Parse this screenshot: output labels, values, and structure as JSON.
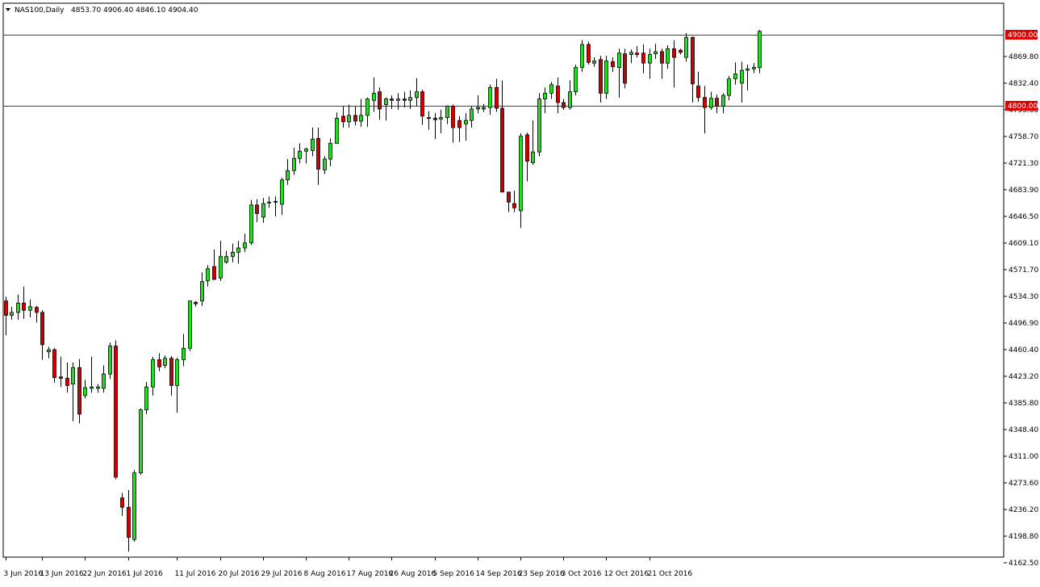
{
  "header": {
    "symbol": "NAS100,Daily",
    "ohlc": "4853.70 4906.40 4846.10 4904.40"
  },
  "colors": {
    "bull": "#22dd22",
    "bear": "#cc0000",
    "wick": "#000000",
    "level_line": "#dd0000",
    "level_label_bg": "#dd0000",
    "level_label_text": "#ffffff",
    "frame": "#000000",
    "background": "#ffffff"
  },
  "chart_data": {
    "type": "candlestick",
    "title": "",
    "xlabel": "",
    "ylabel": "",
    "ylim": [
      4162.5,
      4906.4
    ],
    "grid": false,
    "y_ticks": [
      "4869.80",
      "4832.40",
      "4795.60",
      "4758.70",
      "4721.30",
      "4683.90",
      "4646.50",
      "4609.10",
      "4571.70",
      "4534.30",
      "4496.90",
      "4460.40",
      "4423.20",
      "4385.80",
      "4348.40",
      "4311.00",
      "4273.60",
      "4236.20",
      "4198.80",
      "4162.50"
    ],
    "x_ticks": [
      {
        "index": 0,
        "label": "3 Jun 2016"
      },
      {
        "index": 6,
        "label": "13 Jun 2016"
      },
      {
        "index": 13,
        "label": "22 Jun 2016"
      },
      {
        "index": 20,
        "label": "1 Jul 2016"
      },
      {
        "index": 28,
        "label": "11 Jul 2016"
      },
      {
        "index": 35,
        "label": "20 Jul 2016"
      },
      {
        "index": 42,
        "label": "29 Jul 2016"
      },
      {
        "index": 49,
        "label": "8 Aug 2016"
      },
      {
        "index": 56,
        "label": "17 Aug 2016"
      },
      {
        "index": 63,
        "label": "26 Aug 2016"
      },
      {
        "index": 70,
        "label": "5 Sep 2016"
      },
      {
        "index": 77,
        "label": "14 Sep 2016"
      },
      {
        "index": 84,
        "label": "23 Sep 2016"
      },
      {
        "index": 91,
        "label": "3 Oct 2016"
      },
      {
        "index": 98,
        "label": "12 Oct 2016"
      },
      {
        "index": 105,
        "label": "21 Oct 2016"
      }
    ],
    "levels": [
      {
        "value": 4900.0,
        "label": "4900.00"
      },
      {
        "value": 4800.0,
        "label": "4800.00"
      }
    ],
    "candles": [
      {
        "o": 4528,
        "h": 4534,
        "l": 4480,
        "c": 4508
      },
      {
        "o": 4508,
        "h": 4520,
        "l": 4502,
        "c": 4512
      },
      {
        "o": 4512,
        "h": 4537,
        "l": 4502,
        "c": 4525
      },
      {
        "o": 4525,
        "h": 4548,
        "l": 4503,
        "c": 4515
      },
      {
        "o": 4515,
        "h": 4530,
        "l": 4505,
        "c": 4520
      },
      {
        "o": 4519,
        "h": 4521,
        "l": 4498,
        "c": 4512
      },
      {
        "o": 4512,
        "h": 4515,
        "l": 4446,
        "c": 4467
      },
      {
        "o": 4457,
        "h": 4464,
        "l": 4448,
        "c": 4460
      },
      {
        "o": 4460,
        "h": 4462,
        "l": 4414,
        "c": 4421
      },
      {
        "o": 4422,
        "h": 4450,
        "l": 4408,
        "c": 4420
      },
      {
        "o": 4420,
        "h": 4442,
        "l": 4400,
        "c": 4410
      },
      {
        "o": 4412,
        "h": 4442,
        "l": 4360,
        "c": 4435
      },
      {
        "o": 4435,
        "h": 4447,
        "l": 4357,
        "c": 4370
      },
      {
        "o": 4396,
        "h": 4418,
        "l": 4392,
        "c": 4407
      },
      {
        "o": 4406,
        "h": 4450,
        "l": 4400,
        "c": 4408
      },
      {
        "o": 4406,
        "h": 4412,
        "l": 4400,
        "c": 4408
      },
      {
        "o": 4406,
        "h": 4438,
        "l": 4400,
        "c": 4426
      },
      {
        "o": 4426,
        "h": 4470,
        "l": 4419,
        "c": 4465
      },
      {
        "o": 4465,
        "h": 4473,
        "l": 4279,
        "c": 4282
      },
      {
        "o": 4253,
        "h": 4260,
        "l": 4228,
        "c": 4240
      },
      {
        "o": 4240,
        "h": 4264,
        "l": 4178,
        "c": 4198
      },
      {
        "o": 4195,
        "h": 4292,
        "l": 4192,
        "c": 4288
      },
      {
        "o": 4288,
        "h": 4378,
        "l": 4285,
        "c": 4376
      },
      {
        "o": 4376,
        "h": 4415,
        "l": 4370,
        "c": 4408
      },
      {
        "o": 4408,
        "h": 4450,
        "l": 4396,
        "c": 4446
      },
      {
        "o": 4446,
        "h": 4455,
        "l": 4430,
        "c": 4436
      },
      {
        "o": 4438,
        "h": 4452,
        "l": 4434,
        "c": 4448
      },
      {
        "o": 4448,
        "h": 4451,
        "l": 4396,
        "c": 4410
      },
      {
        "o": 4410,
        "h": 4449,
        "l": 4372,
        "c": 4446
      },
      {
        "o": 4446,
        "h": 4482,
        "l": 4437,
        "c": 4462
      },
      {
        "o": 4462,
        "h": 4525,
        "l": 4458,
        "c": 4528
      },
      {
        "o": 4526,
        "h": 4528,
        "l": 4520,
        "c": 4524
      },
      {
        "o": 4528,
        "h": 4568,
        "l": 4521,
        "c": 4555
      },
      {
        "o": 4556,
        "h": 4578,
        "l": 4548,
        "c": 4573
      },
      {
        "o": 4576,
        "h": 4600,
        "l": 4560,
        "c": 4558
      },
      {
        "o": 4560,
        "h": 4612,
        "l": 4556,
        "c": 4590
      },
      {
        "o": 4582,
        "h": 4598,
        "l": 4580,
        "c": 4590
      },
      {
        "o": 4590,
        "h": 4608,
        "l": 4582,
        "c": 4596
      },
      {
        "o": 4596,
        "h": 4612,
        "l": 4580,
        "c": 4602
      },
      {
        "o": 4602,
        "h": 4622,
        "l": 4596,
        "c": 4609
      },
      {
        "o": 4609,
        "h": 4669,
        "l": 4606,
        "c": 4662
      },
      {
        "o": 4662,
        "h": 4670,
        "l": 4638,
        "c": 4650
      },
      {
        "o": 4645,
        "h": 4672,
        "l": 4637,
        "c": 4664
      },
      {
        "o": 4665,
        "h": 4674,
        "l": 4658,
        "c": 4666
      },
      {
        "o": 4666,
        "h": 4674,
        "l": 4646,
        "c": 4667
      },
      {
        "o": 4663,
        "h": 4700,
        "l": 4648,
        "c": 4697
      },
      {
        "o": 4697,
        "h": 4726,
        "l": 4690,
        "c": 4710
      },
      {
        "o": 4710,
        "h": 4742,
        "l": 4704,
        "c": 4727
      },
      {
        "o": 4727,
        "h": 4748,
        "l": 4720,
        "c": 4737
      },
      {
        "o": 4737,
        "h": 4742,
        "l": 4720,
        "c": 4740
      },
      {
        "o": 4738,
        "h": 4770,
        "l": 4730,
        "c": 4754
      },
      {
        "o": 4755,
        "h": 4770,
        "l": 4690,
        "c": 4712
      },
      {
        "o": 4711,
        "h": 4730,
        "l": 4705,
        "c": 4726
      },
      {
        "o": 4726,
        "h": 4755,
        "l": 4716,
        "c": 4748
      },
      {
        "o": 4748,
        "h": 4791,
        "l": 4748,
        "c": 4783
      },
      {
        "o": 4786,
        "h": 4800,
        "l": 4770,
        "c": 4778
      },
      {
        "o": 4778,
        "h": 4802,
        "l": 4770,
        "c": 4787
      },
      {
        "o": 4787,
        "h": 4800,
        "l": 4773,
        "c": 4779
      },
      {
        "o": 4779,
        "h": 4810,
        "l": 4771,
        "c": 4787
      },
      {
        "o": 4787,
        "h": 4812,
        "l": 4771,
        "c": 4810
      },
      {
        "o": 4808,
        "h": 4840,
        "l": 4792,
        "c": 4818
      },
      {
        "o": 4820,
        "h": 4826,
        "l": 4781,
        "c": 4796
      },
      {
        "o": 4802,
        "h": 4812,
        "l": 4780,
        "c": 4810
      },
      {
        "o": 4810,
        "h": 4815,
        "l": 4796,
        "c": 4808
      },
      {
        "o": 4808,
        "h": 4818,
        "l": 4795,
        "c": 4810
      },
      {
        "o": 4810,
        "h": 4820,
        "l": 4798,
        "c": 4808
      },
      {
        "o": 4808,
        "h": 4822,
        "l": 4796,
        "c": 4812
      },
      {
        "o": 4812,
        "h": 4839,
        "l": 4800,
        "c": 4820
      },
      {
        "o": 4820,
        "h": 4823,
        "l": 4774,
        "c": 4786
      },
      {
        "o": 4784,
        "h": 4793,
        "l": 4767,
        "c": 4783
      },
      {
        "o": 4783,
        "h": 4790,
        "l": 4754,
        "c": 4781
      },
      {
        "o": 4782,
        "h": 4795,
        "l": 4762,
        "c": 4784
      },
      {
        "o": 4784,
        "h": 4801,
        "l": 4775,
        "c": 4800
      },
      {
        "o": 4800,
        "h": 4802,
        "l": 4749,
        "c": 4770
      },
      {
        "o": 4780,
        "h": 4786,
        "l": 4750,
        "c": 4770
      },
      {
        "o": 4775,
        "h": 4790,
        "l": 4752,
        "c": 4780
      },
      {
        "o": 4780,
        "h": 4800,
        "l": 4770,
        "c": 4796
      },
      {
        "o": 4796,
        "h": 4815,
        "l": 4790,
        "c": 4798
      },
      {
        "o": 4796,
        "h": 4803,
        "l": 4792,
        "c": 4798
      },
      {
        "o": 4798,
        "h": 4830,
        "l": 4788,
        "c": 4826
      },
      {
        "o": 4826,
        "h": 4838,
        "l": 4792,
        "c": 4797
      },
      {
        "o": 4797,
        "h": 4836,
        "l": 4783,
        "c": 4680
      },
      {
        "o": 4680,
        "h": 4672,
        "l": 4652,
        "c": 4666
      },
      {
        "o": 4664,
        "h": 4682,
        "l": 4652,
        "c": 4658
      },
      {
        "o": 4654,
        "h": 4762,
        "l": 4630,
        "c": 4758
      },
      {
        "o": 4760,
        "h": 4763,
        "l": 4695,
        "c": 4723
      },
      {
        "o": 4721,
        "h": 4780,
        "l": 4718,
        "c": 4736
      },
      {
        "o": 4736,
        "h": 4818,
        "l": 4730,
        "c": 4810
      },
      {
        "o": 4810,
        "h": 4826,
        "l": 4790,
        "c": 4818
      },
      {
        "o": 4818,
        "h": 4834,
        "l": 4810,
        "c": 4830
      },
      {
        "o": 4828,
        "h": 4840,
        "l": 4790,
        "c": 4805
      },
      {
        "o": 4805,
        "h": 4810,
        "l": 4795,
        "c": 4798
      },
      {
        "o": 4798,
        "h": 4836,
        "l": 4795,
        "c": 4820
      },
      {
        "o": 4820,
        "h": 4858,
        "l": 4815,
        "c": 4854
      },
      {
        "o": 4854,
        "h": 4892,
        "l": 4848,
        "c": 4886
      },
      {
        "o": 4886,
        "h": 4890,
        "l": 4858,
        "c": 4861
      },
      {
        "o": 4860,
        "h": 4868,
        "l": 4855,
        "c": 4863
      },
      {
        "o": 4865,
        "h": 4870,
        "l": 4805,
        "c": 4818
      },
      {
        "o": 4818,
        "h": 4870,
        "l": 4810,
        "c": 4863
      },
      {
        "o": 4862,
        "h": 4868,
        "l": 4848,
        "c": 4855
      },
      {
        "o": 4854,
        "h": 4880,
        "l": 4812,
        "c": 4874
      },
      {
        "o": 4873,
        "h": 4880,
        "l": 4825,
        "c": 4832
      },
      {
        "o": 4872,
        "h": 4879,
        "l": 4860,
        "c": 4875
      },
      {
        "o": 4874,
        "h": 4884,
        "l": 4868,
        "c": 4872
      },
      {
        "o": 4874,
        "h": 4886,
        "l": 4846,
        "c": 4860
      },
      {
        "o": 4860,
        "h": 4880,
        "l": 4838,
        "c": 4872
      },
      {
        "o": 4873,
        "h": 4887,
        "l": 4866,
        "c": 4876
      },
      {
        "o": 4876,
        "h": 4880,
        "l": 4838,
        "c": 4860
      },
      {
        "o": 4860,
        "h": 4885,
        "l": 4852,
        "c": 4880
      },
      {
        "o": 4880,
        "h": 4892,
        "l": 4826,
        "c": 4868
      },
      {
        "o": 4878,
        "h": 4880,
        "l": 4872,
        "c": 4875
      },
      {
        "o": 4868,
        "h": 4902,
        "l": 4862,
        "c": 4896
      },
      {
        "o": 4896,
        "h": 4897,
        "l": 4805,
        "c": 4831
      },
      {
        "o": 4828,
        "h": 4848,
        "l": 4806,
        "c": 4812
      },
      {
        "o": 4812,
        "h": 4828,
        "l": 4762,
        "c": 4798
      },
      {
        "o": 4798,
        "h": 4820,
        "l": 4795,
        "c": 4811
      },
      {
        "o": 4811,
        "h": 4816,
        "l": 4790,
        "c": 4800
      },
      {
        "o": 4800,
        "h": 4818,
        "l": 4790,
        "c": 4815
      },
      {
        "o": 4815,
        "h": 4842,
        "l": 4808,
        "c": 4838
      },
      {
        "o": 4838,
        "h": 4861,
        "l": 4830,
        "c": 4845
      },
      {
        "o": 4832,
        "h": 4862,
        "l": 4805,
        "c": 4850
      },
      {
        "o": 4850,
        "h": 4858,
        "l": 4822,
        "c": 4852
      },
      {
        "o": 4852,
        "h": 4860,
        "l": 4846,
        "c": 4854
      },
      {
        "o": 4853.7,
        "h": 4906.4,
        "l": 4846.1,
        "c": 4904.4
      }
    ]
  }
}
